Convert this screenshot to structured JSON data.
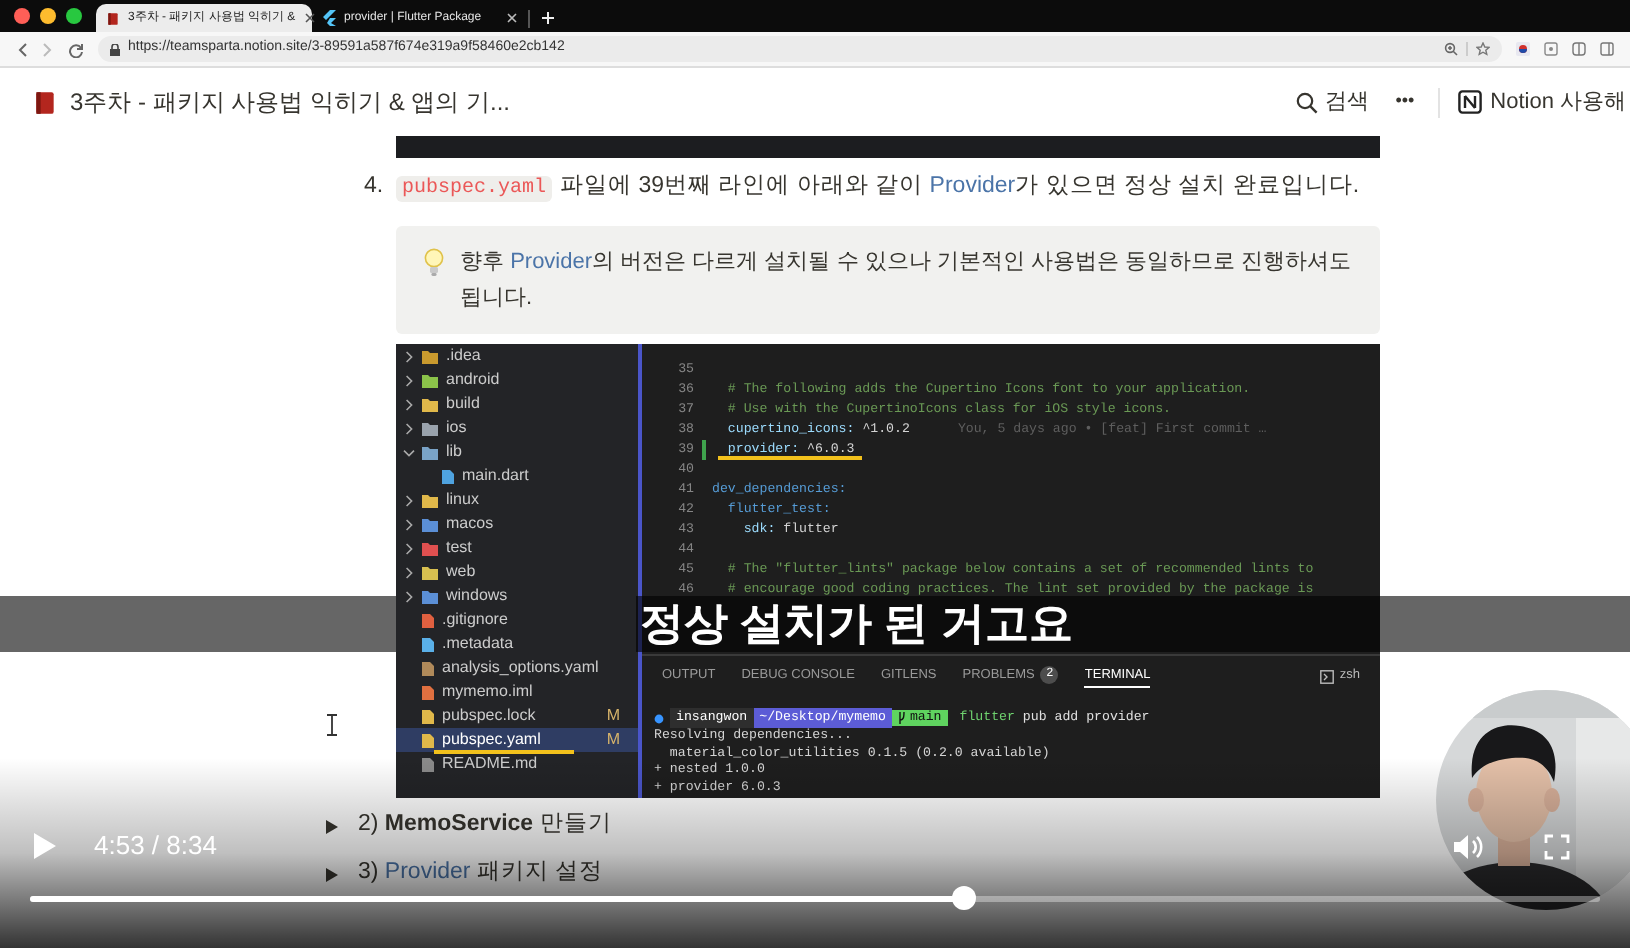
{
  "browser": {
    "tabs": [
      {
        "title": "3주차 - 패키지 사용법 익히기 &",
        "selected": true
      },
      {
        "title": "provider | Flutter Package",
        "selected": false
      }
    ],
    "url": "https://teamsparta.notion.site/3-89591a587f674e319a9f58460e2cb142"
  },
  "page_header": {
    "title": "3주차 - 패키지 사용법 익히기 & 앱의 기...",
    "search": "검색",
    "more": "•••",
    "notion_link": "Notion 사용해"
  },
  "step": {
    "number": "4.",
    "code": "pubspec.yaml",
    "before": "파일에 39번째 라인에 아래와 같이 ",
    "link": "Provider",
    "after": "가 있으면 정상 설치 완료입니다."
  },
  "callout": {
    "before": "향후 ",
    "link": "Provider",
    "after": "의 버전은 다르게 설치될 수 있으나 기본적인 사용법은 동일하므로 진행하셔도 됩니다."
  },
  "screenshot": {
    "file_tree": [
      {
        "label": ".idea",
        "kind": "folder",
        "expanded": false,
        "selected": false,
        "underlined": false,
        "color": "#c99a2e"
      },
      {
        "label": "android",
        "kind": "folder",
        "expanded": false,
        "selected": false,
        "underlined": false,
        "color": "#8bc34a"
      },
      {
        "label": "build",
        "kind": "folder",
        "expanded": false,
        "selected": false,
        "underlined": false,
        "color": "#e0b84a"
      },
      {
        "label": "ios",
        "kind": "folder",
        "expanded": false,
        "selected": false,
        "underlined": false,
        "color": "#9aa3ad"
      },
      {
        "label": "lib",
        "kind": "folder",
        "expanded": true,
        "selected": false,
        "underlined": false,
        "color": "#7aa3c7",
        "children": [
          {
            "label": "main.dart",
            "kind": "file",
            "selected": false,
            "underlined": false,
            "color": "#4fa3e0"
          }
        ]
      },
      {
        "label": "linux",
        "kind": "folder",
        "expanded": false,
        "selected": false,
        "underlined": false,
        "color": "#e0b84a"
      },
      {
        "label": "macos",
        "kind": "folder",
        "expanded": false,
        "selected": false,
        "underlined": false,
        "color": "#5b8fd6"
      },
      {
        "label": "test",
        "kind": "folder",
        "expanded": false,
        "selected": false,
        "underlined": false,
        "color": "#e05050"
      },
      {
        "label": "web",
        "kind": "folder",
        "expanded": false,
        "selected": false,
        "underlined": false,
        "color": "#d8c050"
      },
      {
        "label": "windows",
        "kind": "folder",
        "expanded": false,
        "selected": false,
        "underlined": false,
        "color": "#5b8fd6"
      },
      {
        "label": ".gitignore",
        "kind": "file",
        "selected": false,
        "underlined": false,
        "color": "#e06040"
      },
      {
        "label": ".metadata",
        "kind": "file",
        "selected": false,
        "underlined": false,
        "color": "#5ab0e8"
      },
      {
        "label": "analysis_options.yaml",
        "kind": "file",
        "selected": false,
        "underlined": false,
        "color": "#b08a5a"
      },
      {
        "label": "mymemo.iml",
        "kind": "file",
        "selected": false,
        "underlined": false,
        "color": "#e07040"
      },
      {
        "label": "pubspec.lock",
        "kind": "file",
        "selected": false,
        "underlined": false,
        "color": "#e0b84a",
        "git_status": "M"
      },
      {
        "label": "pubspec.yaml",
        "kind": "file",
        "selected": true,
        "underlined": true,
        "color": "#e0b84a",
        "git_status": "M"
      },
      {
        "label": "README.md",
        "kind": "file",
        "selected": false,
        "underlined": false,
        "color": "#8a8a8a"
      }
    ],
    "editor_lines": [
      {
        "number": "35",
        "kind": "blank",
        "changed": false,
        "underlined": false
      },
      {
        "number": "36",
        "kind": "comment",
        "text": "  # The following adds the Cupertino Icons font to your application.",
        "changed": false,
        "underlined": false
      },
      {
        "number": "37",
        "kind": "comment",
        "text": "  # Use with the CupertinoIcons class for iOS style icons.",
        "changed": false,
        "underlined": false
      },
      {
        "number": "38",
        "kind": "entry",
        "key": "  cupertino_icons:",
        "value": " ^1.0.2",
        "blame": "You, 5 days ago • [feat] First commit …",
        "changed": false,
        "underlined": false
      },
      {
        "number": "39",
        "kind": "entry",
        "key": "  provider:",
        "value": " ^6.0.3",
        "changed": true,
        "underlined": true
      },
      {
        "number": "40",
        "kind": "blank",
        "changed": false,
        "underlined": false
      },
      {
        "number": "41",
        "kind": "section",
        "key": "dev_dependencies:",
        "changed": false,
        "underlined": false
      },
      {
        "number": "42",
        "kind": "section",
        "key": "  flutter_test:",
        "changed": false,
        "underlined": false
      },
      {
        "number": "43",
        "kind": "entry",
        "key": "    sdk:",
        "value": " flutter",
        "changed": false,
        "underlined": false
      },
      {
        "number": "44",
        "kind": "blank",
        "changed": false,
        "underlined": false
      },
      {
        "number": "45",
        "kind": "comment",
        "text": "  # The \"flutter_lints\" package below contains a set of recommended lints to",
        "changed": false,
        "underlined": false
      },
      {
        "number": "46",
        "kind": "comment",
        "text": "  # encourage good coding practices. The lint set provided by the package is",
        "changed": false,
        "underlined": false
      }
    ],
    "panel_tabs": [
      {
        "label": "OUTPUT",
        "selected": false
      },
      {
        "label": "DEBUG CONSOLE",
        "selected": false
      },
      {
        "label": "GITLENS",
        "selected": false
      },
      {
        "label": "PROBLEMS",
        "selected": false,
        "badge": "2"
      },
      {
        "label": "TERMINAL",
        "selected": true
      }
    ],
    "shell": "zsh",
    "prompt": {
      "user": "insangwon",
      "path": "~/Desktop/mymemo",
      "branch": "main",
      "command": "flutter pub add provider"
    },
    "terminal_output": [
      "Resolving dependencies...",
      "  material_color_utilities 0.1.5 (0.2.0 available)",
      "+ nested 1.0.0",
      "+ provider 6.0.3"
    ]
  },
  "toggles": [
    {
      "prefix": "2) ",
      "highlight": "MemoService",
      "kind": "bold",
      "suffix": " 만들기"
    },
    {
      "prefix": "3) ",
      "highlight": "Provider",
      "kind": "link",
      "suffix": " 패키지 설정"
    }
  ],
  "subtitle": "정상 설치가 된 거고요",
  "player": {
    "paused": true,
    "time": "4:53 / 8:34",
    "level": 0.595
  }
}
